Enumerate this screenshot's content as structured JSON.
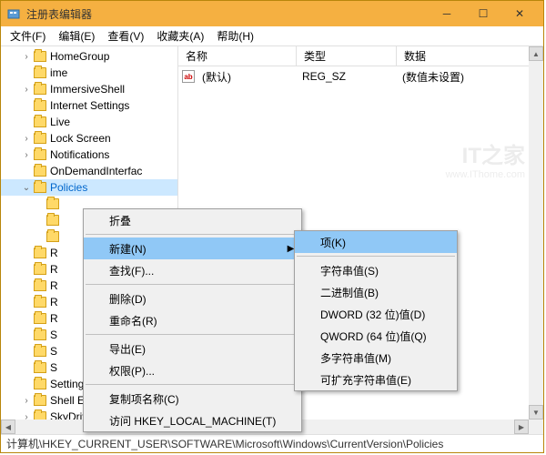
{
  "window": {
    "title": "注册表编辑器"
  },
  "menus": {
    "file": "文件(F)",
    "edit": "编辑(E)",
    "view": "查看(V)",
    "favorites": "收藏夹(A)",
    "help": "帮助(H)"
  },
  "tree": {
    "items": [
      {
        "arrow": "›",
        "indent": 22,
        "label": "HomeGroup"
      },
      {
        "arrow": "",
        "indent": 22,
        "label": "ime"
      },
      {
        "arrow": "›",
        "indent": 22,
        "label": "ImmersiveShell"
      },
      {
        "arrow": "",
        "indent": 22,
        "label": "Internet Settings"
      },
      {
        "arrow": "",
        "indent": 22,
        "label": "Live"
      },
      {
        "arrow": "›",
        "indent": 22,
        "label": "Lock Screen"
      },
      {
        "arrow": "›",
        "indent": 22,
        "label": "Notifications"
      },
      {
        "arrow": "",
        "indent": 22,
        "label": "OnDemandInterfac"
      },
      {
        "arrow": "⌄",
        "indent": 22,
        "label": "Policies",
        "selected": true
      },
      {
        "arrow": "",
        "indent": 36,
        "label": ""
      },
      {
        "arrow": "",
        "indent": 36,
        "label": ""
      },
      {
        "arrow": "",
        "indent": 36,
        "label": ""
      },
      {
        "arrow": "",
        "indent": 22,
        "label": "R"
      },
      {
        "arrow": "",
        "indent": 22,
        "label": "R"
      },
      {
        "arrow": "",
        "indent": 22,
        "label": "R"
      },
      {
        "arrow": "",
        "indent": 22,
        "label": "R"
      },
      {
        "arrow": "",
        "indent": 22,
        "label": "R"
      },
      {
        "arrow": "",
        "indent": 22,
        "label": "S"
      },
      {
        "arrow": "",
        "indent": 22,
        "label": "S"
      },
      {
        "arrow": "",
        "indent": 22,
        "label": "S"
      },
      {
        "arrow": "",
        "indent": 22,
        "label": "SettingSync"
      },
      {
        "arrow": "›",
        "indent": 22,
        "label": "Shell Extensions"
      },
      {
        "arrow": "›",
        "indent": 22,
        "label": "SkyDrive"
      }
    ]
  },
  "columns": {
    "name": "名称",
    "type": "类型",
    "data": "数据"
  },
  "value_row": {
    "icon": "ab",
    "name": "(默认)",
    "type": "REG_SZ",
    "data": "(数值未设置)"
  },
  "context": {
    "collapse": "折叠",
    "new": "新建(N)",
    "find": "查找(F)...",
    "delete": "删除(D)",
    "rename": "重命名(R)",
    "export": "导出(E)",
    "permissions": "权限(P)...",
    "copyname": "复制项名称(C)",
    "goto": "访问 HKEY_LOCAL_MACHINE(T)"
  },
  "submenu": {
    "key": "项(K)",
    "string": "字符串值(S)",
    "binary": "二进制值(B)",
    "dword": "DWORD (32 位)值(D)",
    "qword": "QWORD (64 位)值(Q)",
    "multistring": "多字符串值(M)",
    "expandstring": "可扩充字符串值(E)"
  },
  "statusbar": "计算机\\HKEY_CURRENT_USER\\SOFTWARE\\Microsoft\\Windows\\CurrentVersion\\Policies",
  "watermark": {
    "main": "IT之家",
    "sub": "www.IThome.com"
  }
}
